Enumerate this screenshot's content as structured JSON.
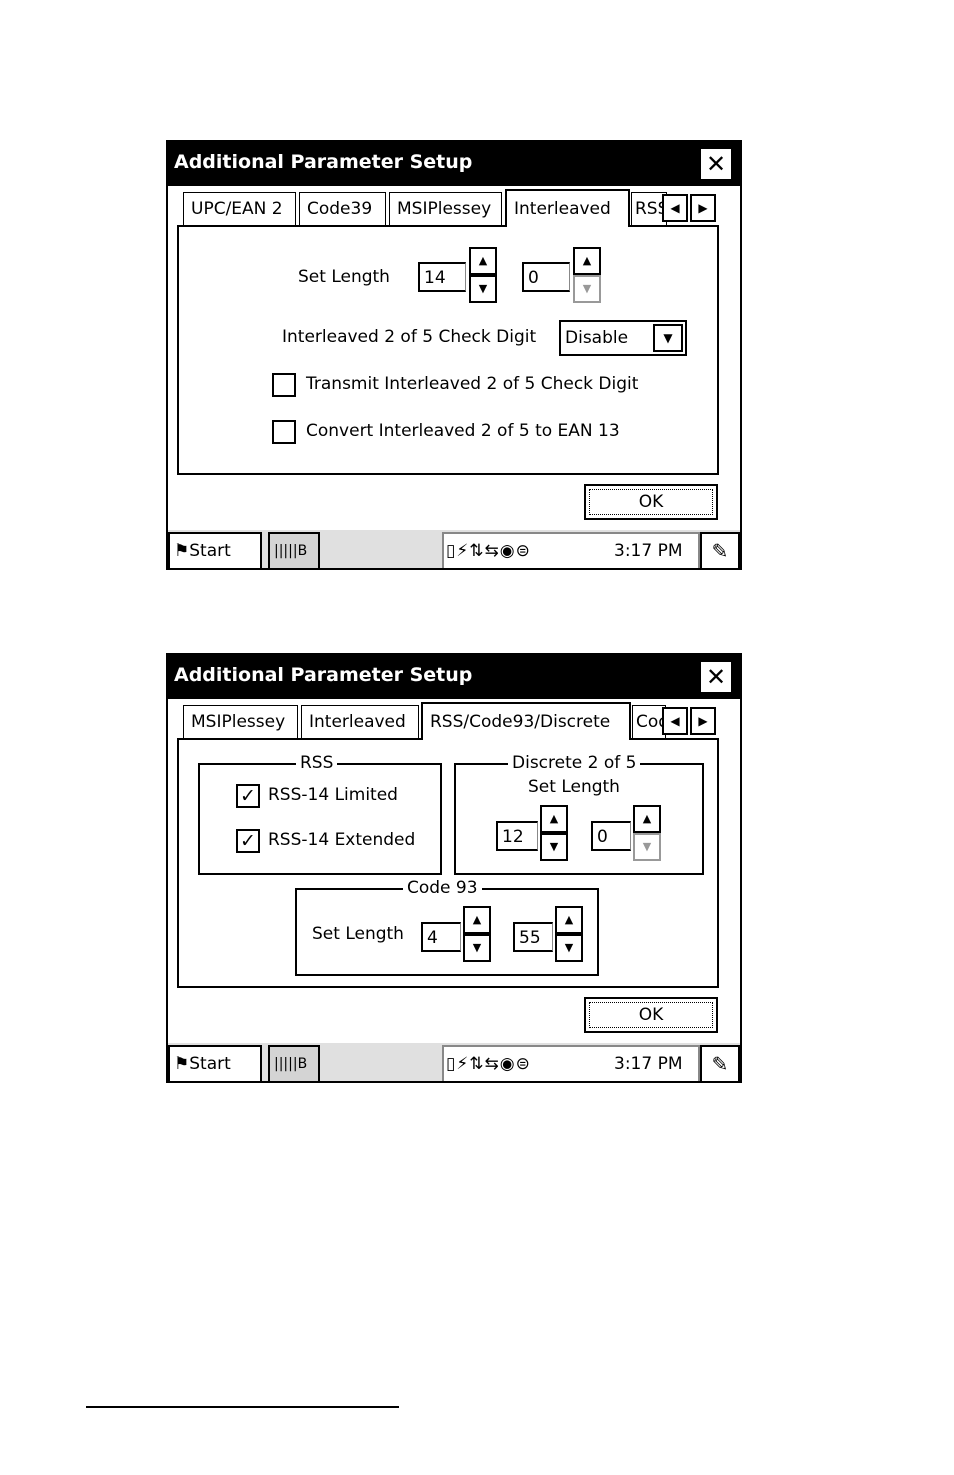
{
  "screen1": {
    "title": "Additional Parameter Setup",
    "close_label": "✕",
    "tabs": [
      "UPC/EAN 2",
      "Code39",
      "MSIPlessey",
      "Interleaved",
      "RSS"
    ],
    "active_tab": "Interleaved",
    "set_length_label": "Set Length",
    "set_length_min": "14",
    "set_length_max": "0",
    "check_digit_label": "Interleaved 2 of 5 Check Digit",
    "check_digit_value": "Disable",
    "transmit_label": "Transmit Interleaved 2 of 5 Check Digit",
    "transmit_checked": false,
    "convert_label": "Convert Interleaved 2 of 5 to EAN 13",
    "convert_checked": false,
    "ok_label": "OK"
  },
  "screen2": {
    "title": "Additional Parameter Setup",
    "close_label": "✕",
    "tabs": [
      "MSIPlessey",
      "Interleaved",
      "RSS/Code93/Discrete",
      "Code"
    ],
    "active_tab": "RSS/Code93/Discrete",
    "rss_group_label": "RSS",
    "rss14_limited_label": "RSS-14 Limited",
    "rss14_limited_checked": true,
    "rss14_extended_label": "RSS-14 Extended",
    "rss14_extended_checked": true,
    "discrete_group_label": "Discrete 2 of 5",
    "discrete_set_length_label": "Set Length",
    "discrete_min": "12",
    "discrete_max": "0",
    "code93_group_label": "Code 93",
    "code93_set_length_label": "Set Length",
    "code93_min": "4",
    "code93_max": "55",
    "ok_label": "OK"
  },
  "taskbar": {
    "start_label": "Start",
    "app_label": "B",
    "time": "3:17 PM",
    "tray_icons": [
      "battery-icon",
      "network-icon",
      "sync-icon",
      "volume-icon",
      "input-icon"
    ]
  },
  "colors": {
    "titlebar_bg": "#000000",
    "titlebar_fg": "#ffffff",
    "taskbar_bg": "#e0e0e0"
  }
}
